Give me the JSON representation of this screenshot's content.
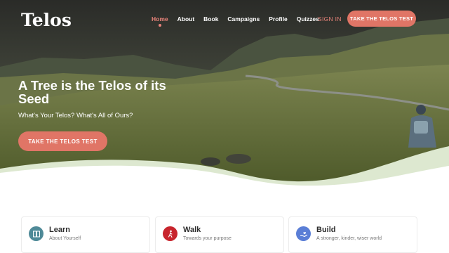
{
  "brand": {
    "logo": "Telos"
  },
  "nav": {
    "items": [
      {
        "label": "Home",
        "active": true
      },
      {
        "label": "About",
        "active": false
      },
      {
        "label": "Book",
        "active": false
      },
      {
        "label": "Campaigns",
        "active": false
      },
      {
        "label": "Profile",
        "active": false
      },
      {
        "label": "Quizzes",
        "active": false
      }
    ],
    "signin": "SIGN IN",
    "cta": "TAKE THE TELOS TEST"
  },
  "hero": {
    "headline": "A Tree is the Telos of its Seed",
    "subhead": "What's Your Telos? What's All of Ours?",
    "cta": "TAKE THE TELOS TEST"
  },
  "features": [
    {
      "title": "Learn",
      "desc": "About Yourself",
      "icon": "book-icon",
      "color": "#4f8a98"
    },
    {
      "title": "Walk",
      "desc": "Towards your purpose",
      "icon": "walking-person-icon",
      "color": "#c8252d"
    },
    {
      "title": "Build",
      "desc": "A stronger, kinder, wiser world",
      "icon": "helping-hand-icon",
      "color": "#5a7ed6"
    }
  ],
  "colors": {
    "accent": "#e07566",
    "wave": "#dde8d0"
  }
}
